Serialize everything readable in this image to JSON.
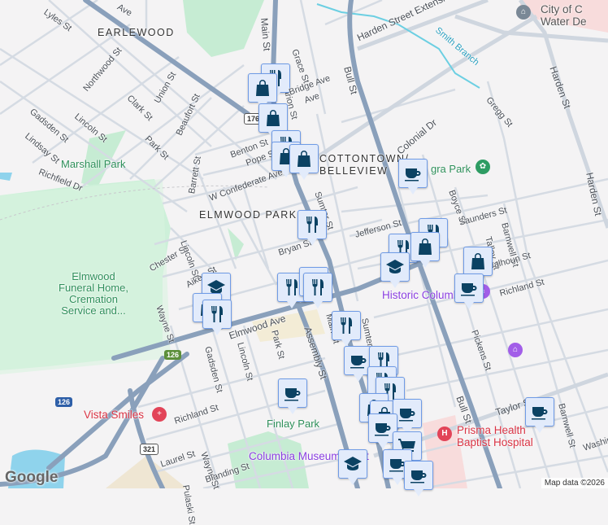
{
  "neighborhoods": [
    "EARLEWOOD",
    "ELMWOOD PARK",
    "COTTONTOWN/",
    "BELLEVIEW"
  ],
  "parks": [
    "Marshall Park",
    "Finlay Park",
    "gra Park"
  ],
  "pois": {
    "funeral": [
      "Elmwood",
      "Funeral Home,",
      "Cremation",
      "Service and..."
    ],
    "dentist": "Vista Smiles",
    "hospital": [
      "Prisma Health",
      "Baptist Hospital"
    ],
    "historic": "Historic Columbia",
    "museum": "Columbia Museum of Art",
    "water": [
      "City of C",
      "Water De"
    ]
  },
  "streets": [
    "Lyles St",
    "Northwood St",
    "Union St",
    "Clark St",
    "Beaufort St",
    "Gadsden St",
    "Lincoln St",
    "Park St",
    "Lindsay St",
    "Richfield Dr",
    "Barrett St",
    "Benton St",
    "Pope St",
    "W Confederate Ave",
    "Chester St",
    "Lincoln St",
    "Aiken St",
    "Wayne St",
    "Elmwood Ave",
    "Gadsden St",
    "Lincoln St",
    "Park St",
    "Assembly St",
    "Richland St",
    "Wayne St",
    "Laurel St",
    "Blanding St",
    "Pulaski St",
    "Main St",
    "Grace St",
    "Marion St",
    "Bull St",
    "Harden Street Extension",
    "Smith Branch",
    "Colonial Dr",
    "Gregg St",
    "Harden St",
    "Harden St",
    "Sumter St",
    "Boyce St",
    "Jefferson St",
    "Saunders St",
    "Talley St",
    "Barnwell St",
    "Bryan St",
    "Sumter St",
    "Calhoun St",
    "Richland St",
    "Pickens St",
    "Bull St",
    "Taylor St",
    "Barnwell St",
    "Washington St",
    "Main St",
    "Ave",
    "Ave",
    "Bridge Ave"
  ],
  "shields": [
    "176",
    "126",
    "126",
    "321"
  ],
  "marker_types": [
    "restaurant",
    "shopping",
    "cafe",
    "education",
    "grocery"
  ],
  "attribution": "Map data ©2026",
  "logo": "Google",
  "colors": {
    "marker_bg": "#e2ebfb",
    "marker_border": "#6f9be6",
    "marker_icon": "#0b4263",
    "highway": "#8aa0bb",
    "park": "#c6ecd3"
  }
}
